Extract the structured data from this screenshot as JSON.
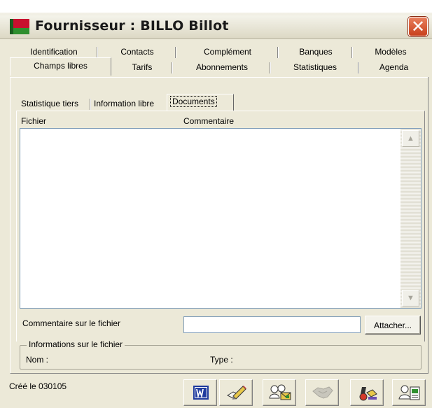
{
  "window": {
    "title": "Fournisseur : BILLO Billot",
    "close_glyph": "✕"
  },
  "tabs": {
    "row1": [
      {
        "label": "Identification"
      },
      {
        "label": "Contacts"
      },
      {
        "label": "Complément"
      },
      {
        "label": "Banques"
      },
      {
        "label": "Modèles"
      }
    ],
    "row2": [
      {
        "label": "Champs libres",
        "active": true
      },
      {
        "label": "Tarifs"
      },
      {
        "label": "Abonnements"
      },
      {
        "label": "Statistiques"
      },
      {
        "label": "Agenda"
      }
    ]
  },
  "subtabs": [
    {
      "label": "Statistique tiers"
    },
    {
      "label": "Information libre"
    },
    {
      "label": "Documents",
      "active": true
    }
  ],
  "list": {
    "columns": [
      "Fichier",
      "Commentaire"
    ],
    "rows": []
  },
  "comment": {
    "label": "Commentaire sur le fichier",
    "value": "",
    "attach_label": "Attacher..."
  },
  "file_info": {
    "legend": "Informations sur le fichier",
    "nom_label": "Nom :",
    "type_label": "Type :"
  },
  "status": {
    "created": "Créé le 030105"
  },
  "toolbar": {
    "buttons": [
      {
        "icon": "word-document-icon",
        "color": "#1f3b9e"
      },
      {
        "icon": "edit-pencil-icon"
      },
      {
        "icon": "users-mail-icon"
      },
      {
        "icon": "handshake-icon"
      },
      {
        "icon": "print-setup-icon"
      },
      {
        "icon": "user-card-icon"
      }
    ]
  },
  "colors": {
    "background": "#ece9d8",
    "close_button": "#d4502c",
    "field_border": "#7f9db9"
  }
}
